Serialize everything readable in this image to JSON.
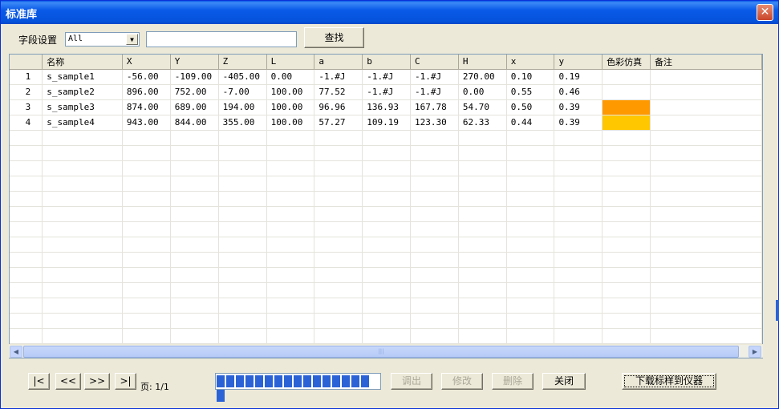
{
  "window": {
    "title": "标准库",
    "close_label": "✕"
  },
  "search": {
    "field_label": "字段设置",
    "field_value": "All",
    "query_value": "",
    "find_label": "查找"
  },
  "grid": {
    "columns": [
      "",
      "名称",
      "X",
      "Y",
      "Z",
      "L",
      "a",
      "b",
      "C",
      "H",
      "x",
      "y",
      "色彩仿真",
      "备注"
    ],
    "rows": [
      {
        "num": "1",
        "name": "s_sample1",
        "X": "-56.00",
        "Y": "-109.00",
        "Z": "-405.00",
        "L": "0.00",
        "a": "-1.#J",
        "b": "-1.#J",
        "C": "-1.#J",
        "H": "270.00",
        "x": "0.10",
        "y": "0.19",
        "color": "",
        "note": ""
      },
      {
        "num": "2",
        "name": "s_sample2",
        "X": "896.00",
        "Y": "752.00",
        "Z": "-7.00",
        "L": "100.00",
        "a": "77.52",
        "b": "-1.#J",
        "C": "-1.#J",
        "H": "0.00",
        "x": "0.55",
        "y": "0.46",
        "color": "",
        "note": ""
      },
      {
        "num": "3",
        "name": "s_sample3",
        "X": "874.00",
        "Y": "689.00",
        "Z": "194.00",
        "L": "100.00",
        "a": "96.96",
        "b": "136.93",
        "C": "167.78",
        "H": "54.70",
        "x": "0.50",
        "y": "0.39",
        "color": "#ff9900",
        "note": ""
      },
      {
        "num": "4",
        "name": "s_sample4",
        "X": "943.00",
        "Y": "844.00",
        "Z": "355.00",
        "L": "100.00",
        "a": "57.27",
        "b": "109.19",
        "C": "123.30",
        "H": "62.33",
        "x": "0.44",
        "y": "0.39",
        "color": "#ffc700",
        "note": ""
      }
    ],
    "empty_row_count": 14
  },
  "pager": {
    "first_label": "|<",
    "prev_label": "<<",
    "next_label": ">>",
    "last_label": ">|",
    "page_text": "页: 1/1"
  },
  "progress": {
    "fraction": 1.0,
    "segments": 17
  },
  "actions": {
    "recall_label": "调出",
    "modify_label": "修改",
    "delete_label": "删除",
    "close_label": "关闭",
    "download_label": "下载标样到仪器"
  },
  "colors": {
    "titlebar": "#0a5ae8",
    "swatch3": "#ff9900",
    "swatch4": "#ffc700",
    "progress": "#2b63d6"
  }
}
